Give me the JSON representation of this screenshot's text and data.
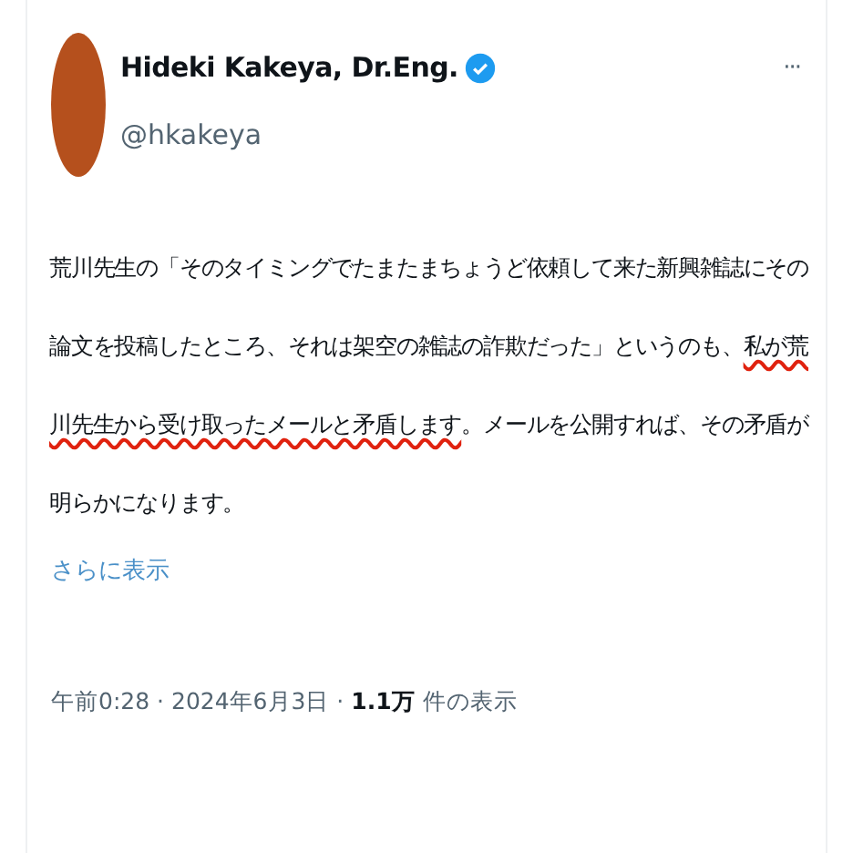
{
  "author": {
    "name": "Hideki Kakeya, Dr.Eng.",
    "handle": "@hkakeya",
    "verified": true
  },
  "more_menu": "···",
  "body": [
    {
      "text": "荒川先生の「そのタイミングでたまたまちょうど依頼して来た新興雑誌にその論文を投稿したところ、それは架空の雑誌の詐欺だった」というのも、",
      "underlined": false
    },
    {
      "text": "私が荒川先生から受け取ったメールと矛盾します",
      "underlined": true
    },
    {
      "text": "。メールを公開すれば、その矛盾が明らかになります。",
      "underlined": false
    }
  ],
  "show_more": "さらに表示",
  "meta": "午前0:28 · 2024年6月3日 · **1.1万** 件の表示"
}
